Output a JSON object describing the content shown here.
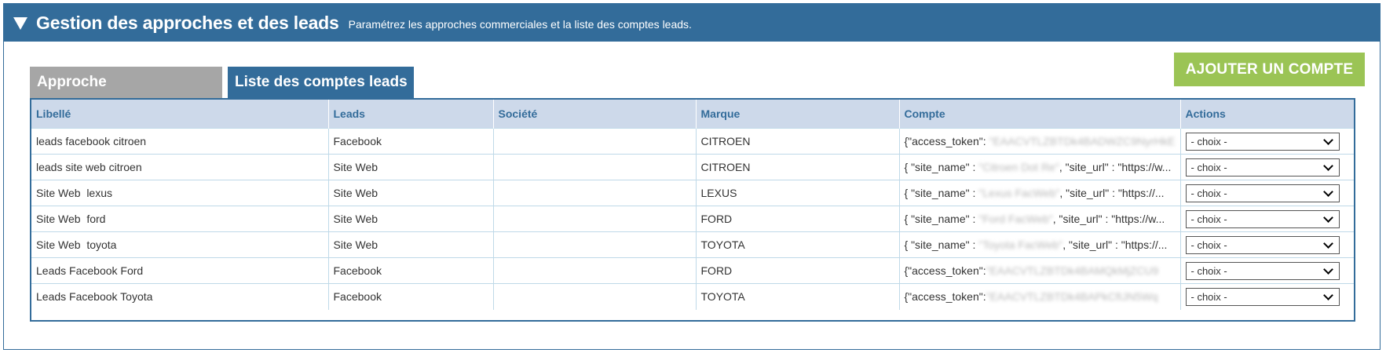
{
  "header": {
    "title": "Gestion des approches et des leads",
    "subtitle": "Paramétrez les approches commerciales et la liste des comptes leads."
  },
  "tabs": [
    {
      "label": "Approche",
      "active": false
    },
    {
      "label": "Liste des comptes leads",
      "active": true
    }
  ],
  "add_button_label": "AJOUTER UN COMPTE",
  "table": {
    "columns": [
      "Libellé",
      "Leads",
      "Société",
      "Marque",
      "Compte",
      "Actions"
    ],
    "rows": [
      {
        "libelle": "leads facebook citroen",
        "leads": "Facebook",
        "societe": "",
        "marque": "CITROEN",
        "compte_prefix": "{\"access_token\":",
        "compte_blur": " \"EAACVTLZBTDk4BADWZC9NyrHkE",
        "compte_suffix": "",
        "action": "- choix -"
      },
      {
        "libelle": "leads site web citroen",
        "leads": "Site Web",
        "societe": "",
        "marque": "CITROEN",
        "compte_prefix": "{ \"site_name\" : ",
        "compte_blur": "\"Citroen Dot Re\"",
        "compte_suffix": ", \"site_url\" : \"https://w...",
        "action": "- choix -"
      },
      {
        "libelle": "Site Web  lexus",
        "leads": "Site Web",
        "societe": "",
        "marque": "LEXUS",
        "compte_prefix": "{ \"site_name\" : ",
        "compte_blur": "\"Lexus FacWeb\"",
        "compte_suffix": ", \"site_url\" : \"https://...",
        "action": "- choix -"
      },
      {
        "libelle": "Site Web  ford",
        "leads": "Site Web",
        "societe": "",
        "marque": "FORD",
        "compte_prefix": "{ \"site_name\" : ",
        "compte_blur": "\"Ford FacWeb\"",
        "compte_suffix": ", \"site_url\" : \"https://w...",
        "action": "- choix -"
      },
      {
        "libelle": "Site Web  toyota",
        "leads": "Site Web",
        "societe": "",
        "marque": "TOYOTA",
        "compte_prefix": "{ \"site_name\" : ",
        "compte_blur": "\"Toyota FacWeb\"",
        "compte_suffix": ", \"site_url\" : \"https://...",
        "action": "- choix -"
      },
      {
        "libelle": "Leads Facebook Ford",
        "leads": "Facebook",
        "societe": "",
        "marque": "FORD",
        "compte_prefix": "{\"access_token\":",
        "compte_blur": "\"EAACVTLZBTDk4BAMQkMjZCU9",
        "compte_suffix": "",
        "action": "- choix -"
      },
      {
        "libelle": "Leads Facebook Toyota",
        "leads": "Facebook",
        "societe": "",
        "marque": "TOYOTA",
        "compte_prefix": "{\"access_token\":",
        "compte_blur": "\"EAACVTLZBTDk4BAPkCfIJN5Wq",
        "compte_suffix": "",
        "action": "- choix -"
      }
    ]
  },
  "colors": {
    "header_bg": "#336c9a",
    "add_button_bg": "#9bc455",
    "inactive_tab_bg": "#a6a6a6",
    "table_header_bg": "#cdd9ea"
  },
  "icons": {
    "collapse": "caret-down-icon",
    "select": "chevron-down-icon"
  }
}
